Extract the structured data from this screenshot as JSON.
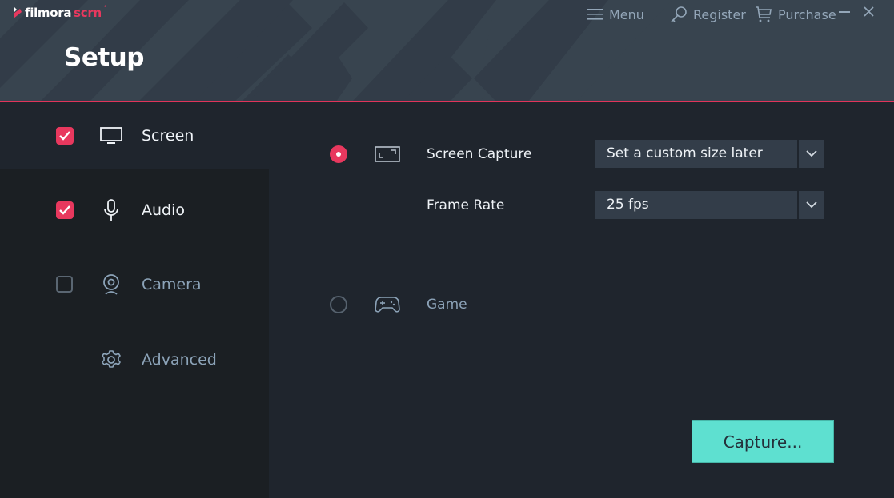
{
  "app": {
    "logo_primary": "filmora",
    "logo_secondary": "scrn",
    "logo_mark": "°"
  },
  "header": {
    "title": "Setup"
  },
  "topnav": {
    "menu": {
      "label": "Menu",
      "icon": "hamburger-icon"
    },
    "register": {
      "label": "Register",
      "icon": "key-icon"
    },
    "purchase": {
      "label": "Purchase",
      "icon": "cart-icon"
    },
    "minimize_icon": "minimize-icon",
    "close_icon": "close-icon"
  },
  "sidebar": {
    "items": [
      {
        "label": "Screen",
        "icon": "monitor-icon",
        "checked": true,
        "active": true
      },
      {
        "label": "Audio",
        "icon": "microphone-icon",
        "checked": true,
        "active": false
      },
      {
        "label": "Camera",
        "icon": "webcam-icon",
        "checked": false,
        "active": false
      },
      {
        "label": "Advanced",
        "icon": "gear-icon",
        "checked": null,
        "active": false
      }
    ]
  },
  "main": {
    "screen_capture": {
      "label": "Screen Capture",
      "selected": true,
      "icon": "fullscreen-icon",
      "value": "Set a custom size later"
    },
    "frame_rate": {
      "label": "Frame Rate",
      "value": "25 fps"
    },
    "game": {
      "label": "Game",
      "selected": false,
      "icon": "gamepad-icon"
    },
    "capture_button": "Capture..."
  },
  "colors": {
    "accent": "#e8385e",
    "capture_button": "#5ee0d0",
    "header_bg": "#38444f",
    "panel_bg": "#1f252d",
    "sidebar_bg": "#1b1f23"
  }
}
